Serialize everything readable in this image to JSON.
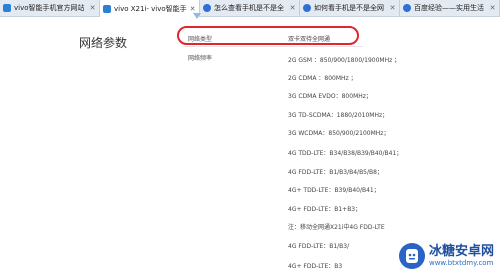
{
  "tabs": [
    {
      "label": "vivo智能手机官方网站",
      "icon": "blue-square-icon"
    },
    {
      "label": "vivo X21i- vivo智能手",
      "icon": "blue-square-icon",
      "active": true
    },
    {
      "label": "怎么查看手机是不是全",
      "icon": "paw-icon"
    },
    {
      "label": "如何看手机是不是全网",
      "icon": "paw-icon"
    },
    {
      "label": "百度经验——实用生活",
      "icon": "paw-icon"
    }
  ],
  "section_title": "网络参数",
  "rows": [
    {
      "label": "网络类型",
      "value": "双卡双待全网通"
    },
    {
      "label": "网络频率",
      "value": "2G GSM ：850/900/1800/1900MHz ；"
    }
  ],
  "specs": [
    "2G CDMA ：800MHz ；",
    "3G CDMA EVDO：800MHz；",
    "3G TD-SCDMA：1880/2010MHz；",
    "3G WCDMA：850/900/2100MHz；",
    "4G TDD-LTE：B34/B38/B39/B40/B41；",
    "4G FDD-LTE：B1/B3/B4/B5/B8；",
    "4G+ TDD-LTE：B39/B40/B41；",
    "4G+ FDD-LTE：B1+B3；",
    "注：移动全网通X21i中4G FDD-LTE",
    "4G FDD-LTE：B1/B3/",
    "4G+ FDD-LTE：B3"
  ],
  "watermark": {
    "title": "冰糖安卓网",
    "url": "www.btxtdmy.com"
  },
  "colors": {
    "highlight": "#e0262f",
    "brand": "#2a64c6"
  }
}
